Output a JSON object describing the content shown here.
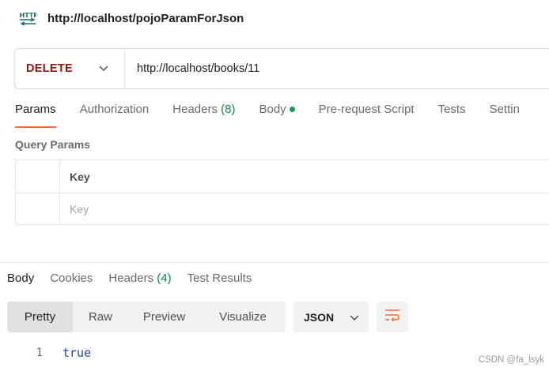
{
  "request": {
    "icon": "http-icon",
    "title": "http://localhost/pojoParamForJson"
  },
  "url_bar": {
    "method": "DELETE",
    "url": "http://localhost/books/11"
  },
  "request_tabs": [
    {
      "label": "Params",
      "active": true
    },
    {
      "label": "Authorization"
    },
    {
      "label": "Headers",
      "count": "(8)"
    },
    {
      "label": "Body",
      "dot": true
    },
    {
      "label": "Pre-request Script"
    },
    {
      "label": "Tests"
    },
    {
      "label": "Settin"
    }
  ],
  "query_params": {
    "label": "Query Params",
    "key_header": "Key",
    "key_placeholder": "Key"
  },
  "response_tabs": [
    {
      "label": "Body",
      "active": true
    },
    {
      "label": "Cookies"
    },
    {
      "label": "Headers",
      "count": "(4)"
    },
    {
      "label": "Test Results"
    }
  ],
  "view_modes": [
    {
      "label": "Pretty",
      "active": true
    },
    {
      "label": "Raw"
    },
    {
      "label": "Preview"
    },
    {
      "label": "Visualize"
    }
  ],
  "format_select": {
    "value": "JSON"
  },
  "response_body": [
    {
      "line": "1",
      "text": "true"
    }
  ],
  "watermark": "CSDN @fa_lsyk",
  "colors": {
    "accent": "#ff6c37",
    "delete_method": "#8e1a10",
    "count_green": "#0f8a42",
    "code_blue": "#1a4fa3"
  }
}
